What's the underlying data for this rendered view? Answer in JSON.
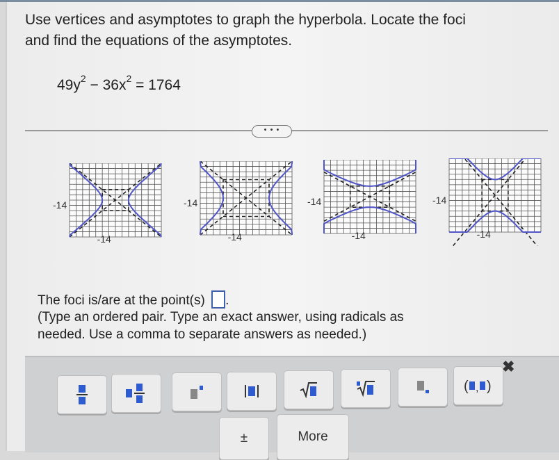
{
  "question": {
    "line1": "Use vertices and asymptotes to graph the hyperbola. Locate the foci",
    "line2": "and find the equations of the asymptotes.",
    "equation": {
      "a": "49y",
      "sup1": "2",
      "b": " − 36x",
      "sup2": "2",
      "c": " = 1764"
    }
  },
  "expand_button": "• • •",
  "graphs": [
    {
      "name": "option-a",
      "label_y": "-14",
      "label_x": "-14",
      "orientation": "horizontal",
      "hint": "vertices at x = ±4"
    },
    {
      "name": "option-b",
      "label_y": "-14",
      "label_x": "-14",
      "orientation": "horizontal",
      "hint": "vertices at x = ±7"
    },
    {
      "name": "option-c",
      "label_y": "-14",
      "label_x": "-14",
      "orientation": "vertical",
      "hint": "vertices at y = ±4"
    },
    {
      "name": "option-d",
      "label_y": "-14",
      "label_x": "-14",
      "orientation": "vertical",
      "hint": "vertices at y = ±6"
    }
  ],
  "answer": {
    "prompt": "The foci is/are at the point(s)",
    "value": "",
    "suffix": ".",
    "instruction_line1": "(Type an ordered pair. Type an exact answer, using radicals as",
    "instruction_line2": "needed. Use a comma to separate answers as needed.)"
  },
  "palette": {
    "buttons": [
      {
        "icon": "fraction-icon"
      },
      {
        "icon": "mixed-number-icon"
      },
      {
        "icon": "exponent-icon"
      },
      {
        "icon": "absolute-value-icon"
      },
      {
        "icon": "square-root-icon"
      },
      {
        "icon": "nth-root-icon"
      },
      {
        "icon": "subscript-icon"
      },
      {
        "icon": "ordered-pair-icon"
      }
    ],
    "plus_minus": "±",
    "more": "More",
    "close": "✖"
  },
  "colors": {
    "curve": "#5055c8",
    "accent": "#2f5bd0",
    "input_border": "#3f5fa8"
  }
}
